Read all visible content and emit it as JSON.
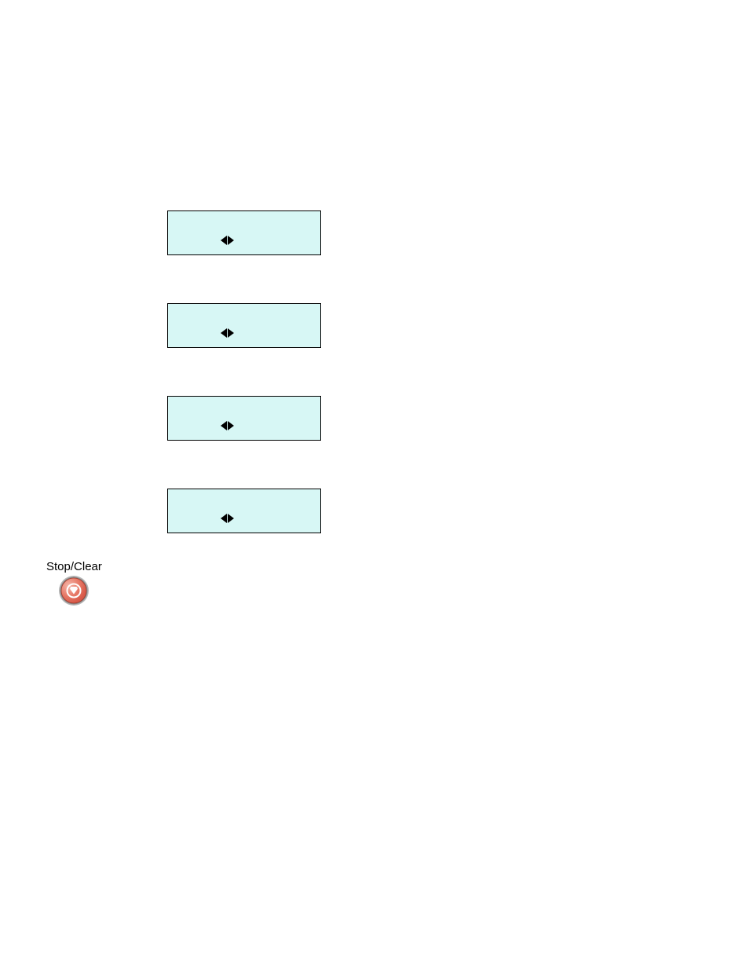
{
  "lcd_screens": {
    "screen1": {
      "arrows": true
    },
    "screen2": {
      "arrows": true
    },
    "screen3": {
      "arrows": true
    },
    "screen4": {
      "arrows": true
    }
  },
  "button": {
    "label": "Stop/Clear"
  }
}
